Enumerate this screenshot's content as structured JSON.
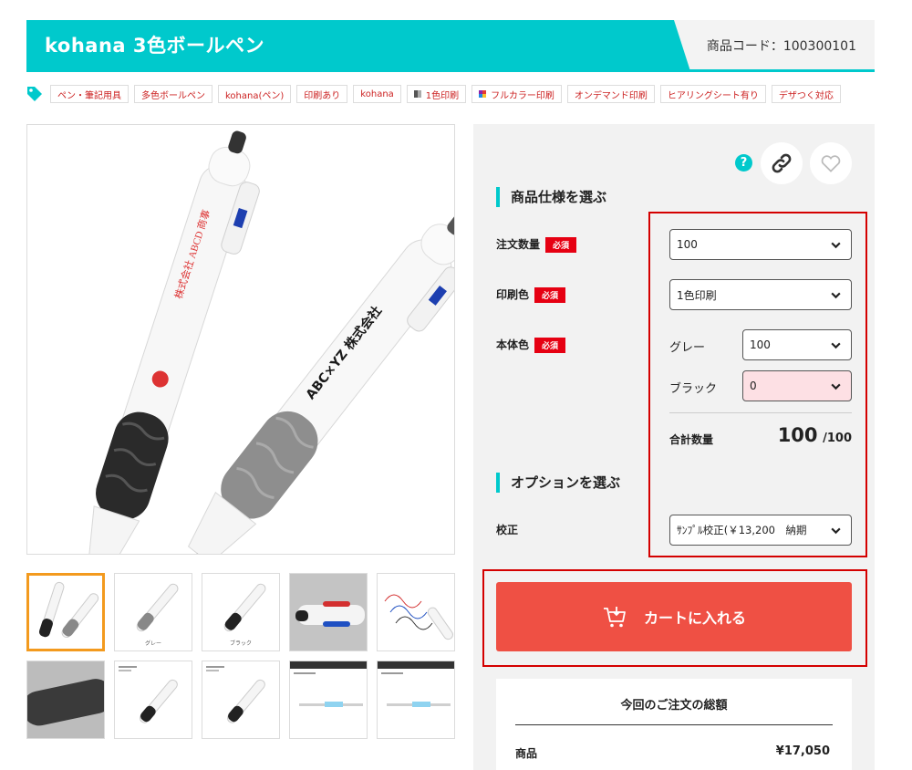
{
  "header": {
    "title": "kohana 3色ボールペン",
    "product_code": "商品コード：100300101"
  },
  "tags": [
    {
      "label": "ペン・筆記用具",
      "swatch": ""
    },
    {
      "label": "多色ボールペン",
      "swatch": ""
    },
    {
      "label": "kohana(ペン)",
      "swatch": ""
    },
    {
      "label": "印刷あり",
      "swatch": ""
    },
    {
      "label": "kohana",
      "swatch": ""
    },
    {
      "label": "1色印刷",
      "swatch": "mono"
    },
    {
      "label": "フルカラー印刷",
      "swatch": "color"
    },
    {
      "label": "オンデマンド印刷",
      "swatch": ""
    },
    {
      "label": "ヒアリングシート有り",
      "swatch": ""
    },
    {
      "label": "デザつく対応",
      "swatch": ""
    }
  ],
  "main_image": {
    "print_left": "株式会社 ABCD 商事",
    "print_right": "ABC×YZ 株式会社"
  },
  "thumbnails": [
    {
      "caption": ""
    },
    {
      "caption": "グレー"
    },
    {
      "caption": "ブラック"
    },
    {
      "caption": ""
    },
    {
      "caption": ""
    },
    {
      "caption": ""
    },
    {
      "caption": ""
    },
    {
      "caption": ""
    },
    {
      "caption": ""
    },
    {
      "caption": ""
    }
  ],
  "panel": {
    "help": "?",
    "spec_title": "商品仕様を選ぶ",
    "required": "必須",
    "quantity": {
      "label": "注文数量",
      "value": "100"
    },
    "print_color": {
      "label": "印刷色",
      "value": "1色印刷"
    },
    "body_color": {
      "label": "本体色",
      "gray": {
        "label": "グレー",
        "value": "100"
      },
      "black": {
        "label": "ブラック",
        "value": "0"
      }
    },
    "total": {
      "label": "合計数量",
      "value": "100",
      "max": "/100"
    },
    "option_title": "オプションを選ぶ",
    "proof": {
      "label": "校正",
      "value": "ｻﾝﾌﾟﾙ校正(￥13,200　納期"
    }
  },
  "cart_button": {
    "label": "カートに入れる"
  },
  "summary": {
    "title": "今回のご注文の総額",
    "rows": [
      {
        "label": "商品",
        "value": "¥17,050"
      }
    ]
  },
  "colors": {
    "accent": "#00c9cc",
    "cart": "#ef5044",
    "required": "#e60012",
    "highlight_box": "#d40000",
    "thumb_active": "#f39a1e"
  }
}
